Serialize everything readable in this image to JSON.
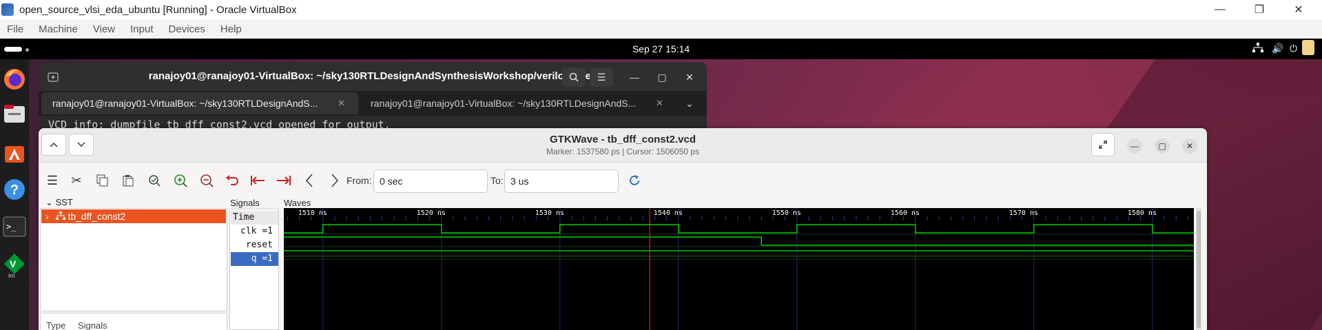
{
  "host": {
    "title": "open_source_vlsi_eda_ubuntu [Running] - Oracle VirtualBox",
    "menus": [
      "File",
      "Machine",
      "View",
      "Input",
      "Devices",
      "Help"
    ],
    "controls": {
      "minimize": "—",
      "restore": "❐",
      "close": "✕"
    }
  },
  "guest": {
    "clock": "Sep 27  15:14",
    "dock": [
      "firefox-icon",
      "files-icon",
      "app-center-icon",
      "help-icon",
      "terminal-icon",
      "vim-icon"
    ]
  },
  "terminal": {
    "title": "ranajoy01@ranajoy01-VirtualBox: ~/sky130RTLDesignAndSynthesisWorkshop/verilog_files",
    "tabs": [
      "ranajoy01@ranajoy01-VirtualBox: ~/sky130RTLDesignAndS...",
      "ranajoy01@ranajoy01-VirtualBox: ~/sky130RTLDesignAndS..."
    ],
    "visible_text": "VCD info: dumpfile tb_dff_const2.vcd opened for output."
  },
  "gtkwave": {
    "title": "GTKWave - tb_dff_const2.vcd",
    "subtitle": "Marker: 1537580 ps  |  Cursor: 1506050 ps",
    "from_label": "From:",
    "from_value": "0 sec",
    "to_label": "To:",
    "to_value": "3 us",
    "sst_label": "SST",
    "sst_item": "tb_dff_const2",
    "sst_lower": {
      "type": "Type",
      "signals": "Signals"
    },
    "signals_label": "Signals",
    "waves_label": "Waves",
    "signals": [
      {
        "label": "Time"
      },
      {
        "label": "clk =1"
      },
      {
        "label": "reset =1"
      },
      {
        "label": "q =1"
      }
    ],
    "time_ticks": [
      "1510 ns",
      "1520 ns",
      "1530 ns",
      "1540 ns",
      "1550 ns",
      "1560 ns",
      "1570 ns",
      "1580 ns"
    ],
    "wave_colors": {
      "trace": "#00d000",
      "grid": "#24246e",
      "marker": "#ff3030",
      "background": "#000000"
    },
    "waveforms": {
      "view_start_ns": 1506.7,
      "view_end_ns": 1583.5,
      "clk_rise_ns": [
        1510,
        1530,
        1550,
        1570
      ],
      "clk_fall_ns": [
        1520,
        1540,
        1560,
        1580
      ],
      "reset_fall_ns": 1547,
      "q_value": 1,
      "marker_ns": 1537.58
    }
  }
}
